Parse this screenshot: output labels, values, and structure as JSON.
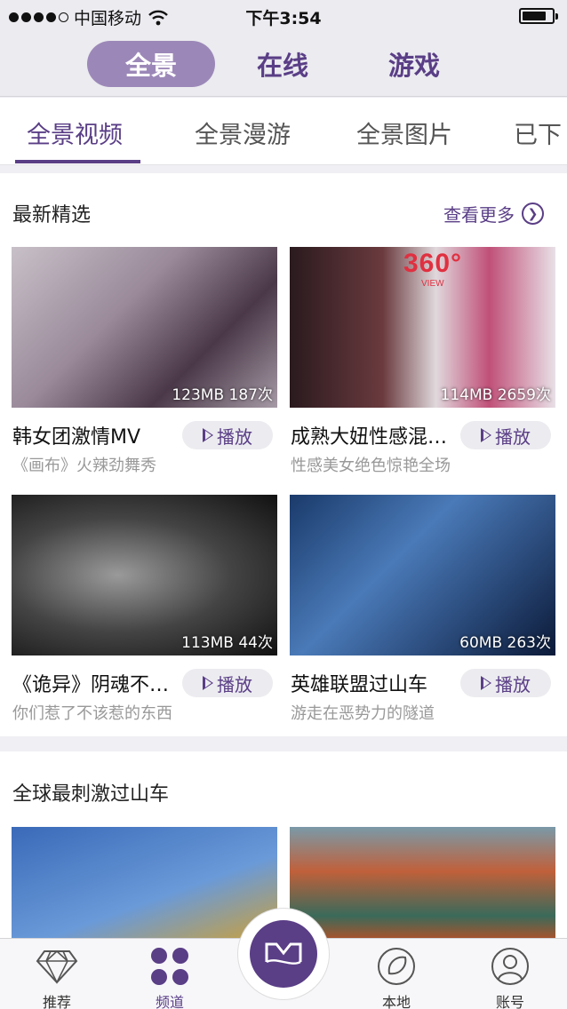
{
  "status_bar": {
    "carrier": "中国移动",
    "time": "下午3:54"
  },
  "top_nav": {
    "segments": [
      "全景",
      "在线",
      "游戏"
    ],
    "active_index": 0
  },
  "sub_tabs": {
    "items": [
      "全景视频",
      "全景漫游",
      "全景图片",
      "已下"
    ],
    "active_index": 0
  },
  "section_latest": {
    "title": "最新精选",
    "more_label": "查看更多",
    "play_label": "播放",
    "cards": [
      {
        "title": "韩女团激情MV",
        "desc": "《画布》火辣劲舞秀",
        "meta": "123MB 187次"
      },
      {
        "title": "成熟大妞性感混…",
        "desc": "性感美女绝色惊艳全场",
        "meta": "114MB 2659次",
        "badge": "360°",
        "badge_sub": "VIEW"
      },
      {
        "title": "《诡异》阴魂不…",
        "desc": "你们惹了不该惹的东西",
        "meta": "113MB 44次"
      },
      {
        "title": "英雄联盟过山车",
        "desc": "游走在恶势力的隧道",
        "meta": "60MB 263次"
      }
    ]
  },
  "section_coaster": {
    "title": "全球最刺激过山车"
  },
  "bottom_bar": {
    "items": [
      {
        "label": "推荐",
        "icon": "diamond-icon"
      },
      {
        "label": "频道",
        "icon": "four-dots-icon"
      },
      {
        "label": "",
        "icon": "brand-logo-icon"
      },
      {
        "label": "本地",
        "icon": "local-icon"
      },
      {
        "label": "账号",
        "icon": "user-icon"
      }
    ],
    "active_index": 1
  },
  "colors": {
    "accent": "#5a3e86",
    "segment_active_bg": "#9c88b8"
  }
}
